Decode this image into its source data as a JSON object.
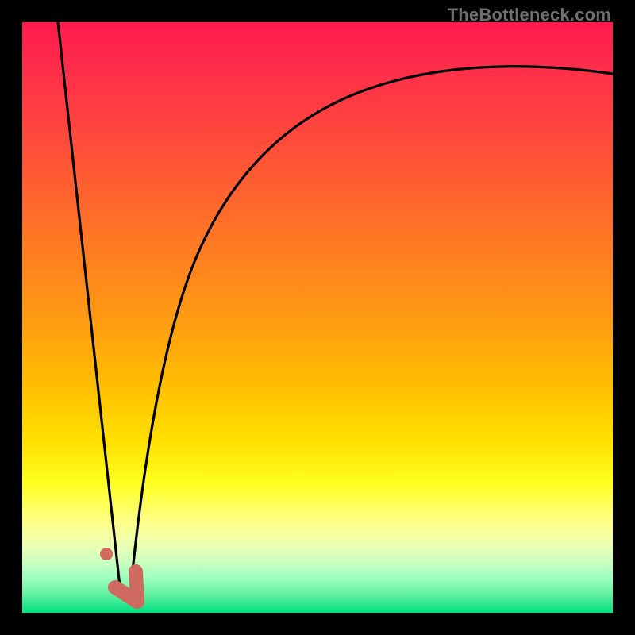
{
  "watermark": "TheBottleneck.com",
  "chart_data": {
    "type": "line",
    "title": "",
    "xlabel": "",
    "ylabel": "",
    "xlim": [
      0,
      100
    ],
    "ylim": [
      0,
      100
    ],
    "grid": false,
    "legend": false,
    "background": "heatmap-gradient",
    "gradient_meaning": "vertical: 100 at top (red/bad) to 0 at bottom (green/good)",
    "series": [
      {
        "name": "left-branch",
        "x": [
          6,
          8,
          10,
          12,
          14,
          15.5,
          16.5
        ],
        "y": [
          100,
          84,
          68,
          50,
          32,
          15,
          3
        ]
      },
      {
        "name": "right-branch",
        "x": [
          18,
          20,
          23,
          27,
          32,
          38,
          45,
          55,
          68,
          82,
          100
        ],
        "y": [
          3,
          18,
          38,
          55,
          67,
          75,
          80,
          84,
          87,
          89,
          91
        ]
      }
    ],
    "marker": {
      "name": "optimal-point",
      "shape": "L",
      "x": 17,
      "y": 2
    },
    "secondary_marker": {
      "name": "small-dot",
      "x": 14,
      "y": 8
    }
  }
}
